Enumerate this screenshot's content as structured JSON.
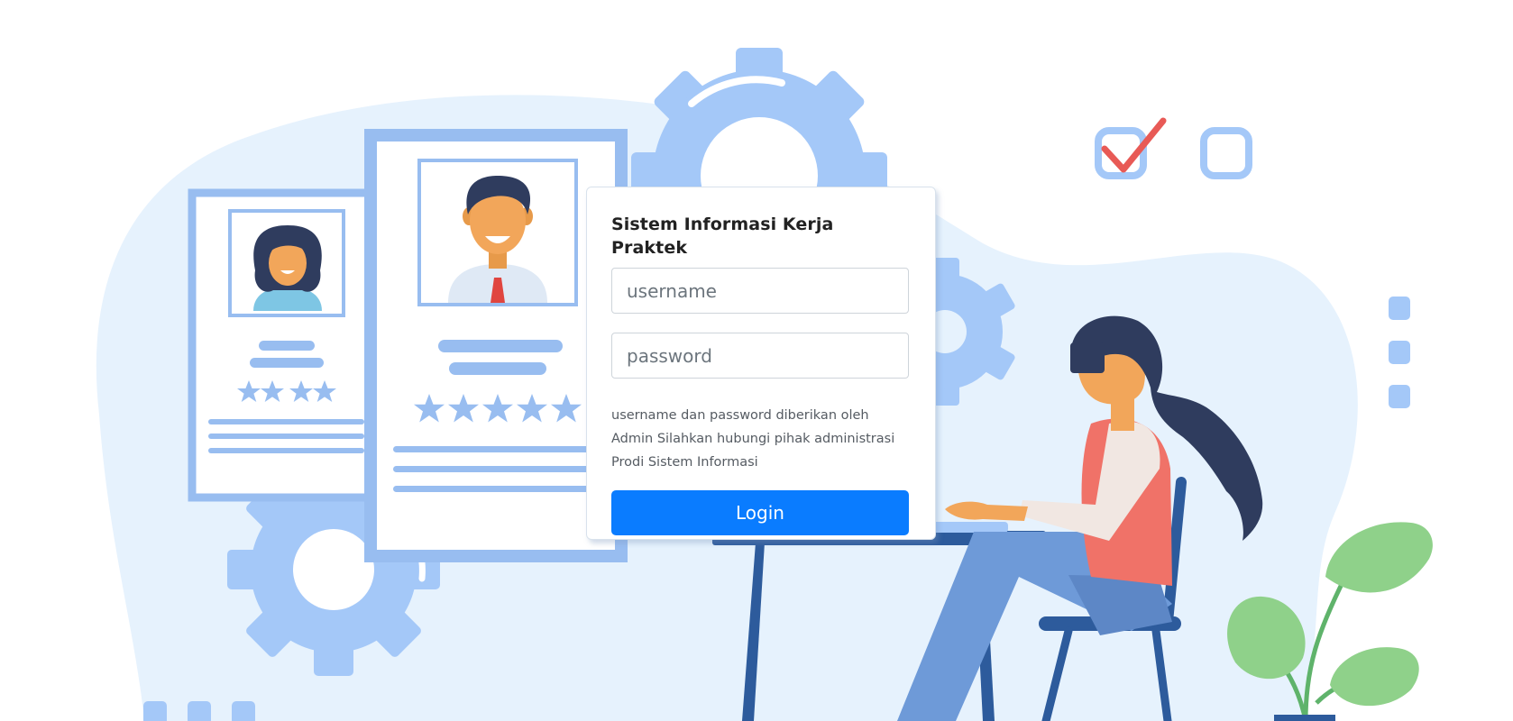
{
  "login": {
    "title": "Sistem Informasi Kerja Praktek",
    "username_placeholder": "username",
    "username_value": "",
    "password_placeholder": "password",
    "password_value": "",
    "note": "username dan password diberikan oleh Admin Silahkan hubungi pihak administrasi Prodi Sistem Informasi",
    "button_label": "Login"
  },
  "illustration": {
    "blob_color": "#e6f2fd",
    "accent_color": "#a4c8f8",
    "frame_color": "#98bdf0",
    "checkbox_checked": true,
    "checkbox_unchecked": false,
    "profile_card_left_rating": 4,
    "profile_card_right_rating": 5
  },
  "colors": {
    "primary": "#0a7cff",
    "check_mark": "#e85a56",
    "plant_leaf": "#8fd18a",
    "hair": "#2f3c5e",
    "shirt_vest": "#f07268",
    "pants": "#6e9ad8"
  }
}
